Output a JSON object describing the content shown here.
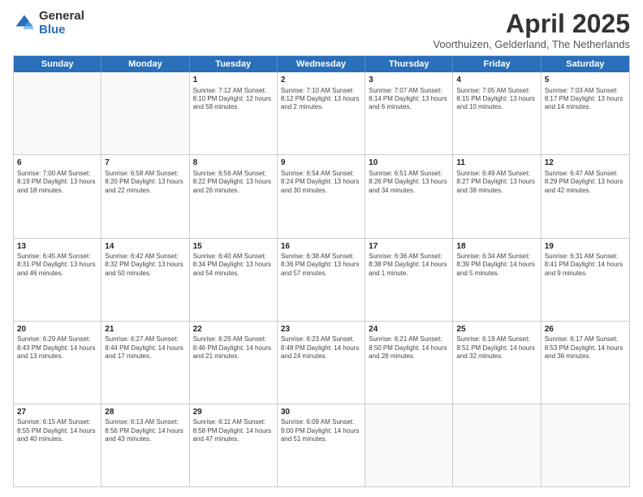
{
  "logo": {
    "general": "General",
    "blue": "Blue"
  },
  "title": "April 2025",
  "subtitle": "Voorthuizen, Gelderland, The Netherlands",
  "calendar": {
    "headers": [
      "Sunday",
      "Monday",
      "Tuesday",
      "Wednesday",
      "Thursday",
      "Friday",
      "Saturday"
    ],
    "rows": [
      [
        {
          "day": "",
          "info": ""
        },
        {
          "day": "",
          "info": ""
        },
        {
          "day": "1",
          "info": "Sunrise: 7:12 AM\nSunset: 8:10 PM\nDaylight: 12 hours\nand 58 minutes."
        },
        {
          "day": "2",
          "info": "Sunrise: 7:10 AM\nSunset: 8:12 PM\nDaylight: 13 hours\nand 2 minutes."
        },
        {
          "day": "3",
          "info": "Sunrise: 7:07 AM\nSunset: 8:14 PM\nDaylight: 13 hours\nand 6 minutes."
        },
        {
          "day": "4",
          "info": "Sunrise: 7:05 AM\nSunset: 8:15 PM\nDaylight: 13 hours\nand 10 minutes."
        },
        {
          "day": "5",
          "info": "Sunrise: 7:03 AM\nSunset: 8:17 PM\nDaylight: 13 hours\nand 14 minutes."
        }
      ],
      [
        {
          "day": "6",
          "info": "Sunrise: 7:00 AM\nSunset: 8:19 PM\nDaylight: 13 hours\nand 18 minutes."
        },
        {
          "day": "7",
          "info": "Sunrise: 6:58 AM\nSunset: 8:20 PM\nDaylight: 13 hours\nand 22 minutes."
        },
        {
          "day": "8",
          "info": "Sunrise: 6:56 AM\nSunset: 8:22 PM\nDaylight: 13 hours\nand 26 minutes."
        },
        {
          "day": "9",
          "info": "Sunrise: 6:54 AM\nSunset: 8:24 PM\nDaylight: 13 hours\nand 30 minutes."
        },
        {
          "day": "10",
          "info": "Sunrise: 6:51 AM\nSunset: 8:26 PM\nDaylight: 13 hours\nand 34 minutes."
        },
        {
          "day": "11",
          "info": "Sunrise: 6:49 AM\nSunset: 8:27 PM\nDaylight: 13 hours\nand 38 minutes."
        },
        {
          "day": "12",
          "info": "Sunrise: 6:47 AM\nSunset: 8:29 PM\nDaylight: 13 hours\nand 42 minutes."
        }
      ],
      [
        {
          "day": "13",
          "info": "Sunrise: 6:45 AM\nSunset: 8:31 PM\nDaylight: 13 hours\nand 46 minutes."
        },
        {
          "day": "14",
          "info": "Sunrise: 6:42 AM\nSunset: 8:32 PM\nDaylight: 13 hours\nand 50 minutes."
        },
        {
          "day": "15",
          "info": "Sunrise: 6:40 AM\nSunset: 8:34 PM\nDaylight: 13 hours\nand 54 minutes."
        },
        {
          "day": "16",
          "info": "Sunrise: 6:38 AM\nSunset: 8:36 PM\nDaylight: 13 hours\nand 57 minutes."
        },
        {
          "day": "17",
          "info": "Sunrise: 6:36 AM\nSunset: 8:38 PM\nDaylight: 14 hours\nand 1 minute."
        },
        {
          "day": "18",
          "info": "Sunrise: 6:34 AM\nSunset: 8:39 PM\nDaylight: 14 hours\nand 5 minutes."
        },
        {
          "day": "19",
          "info": "Sunrise: 6:31 AM\nSunset: 8:41 PM\nDaylight: 14 hours\nand 9 minutes."
        }
      ],
      [
        {
          "day": "20",
          "info": "Sunrise: 6:29 AM\nSunset: 8:43 PM\nDaylight: 14 hours\nand 13 minutes."
        },
        {
          "day": "21",
          "info": "Sunrise: 6:27 AM\nSunset: 8:44 PM\nDaylight: 14 hours\nand 17 minutes."
        },
        {
          "day": "22",
          "info": "Sunrise: 6:25 AM\nSunset: 8:46 PM\nDaylight: 14 hours\nand 21 minutes."
        },
        {
          "day": "23",
          "info": "Sunrise: 6:23 AM\nSunset: 8:48 PM\nDaylight: 14 hours\nand 24 minutes."
        },
        {
          "day": "24",
          "info": "Sunrise: 6:21 AM\nSunset: 8:50 PM\nDaylight: 14 hours\nand 28 minutes."
        },
        {
          "day": "25",
          "info": "Sunrise: 6:19 AM\nSunset: 8:51 PM\nDaylight: 14 hours\nand 32 minutes."
        },
        {
          "day": "26",
          "info": "Sunrise: 6:17 AM\nSunset: 8:53 PM\nDaylight: 14 hours\nand 36 minutes."
        }
      ],
      [
        {
          "day": "27",
          "info": "Sunrise: 6:15 AM\nSunset: 8:55 PM\nDaylight: 14 hours\nand 40 minutes."
        },
        {
          "day": "28",
          "info": "Sunrise: 6:13 AM\nSunset: 8:56 PM\nDaylight: 14 hours\nand 43 minutes."
        },
        {
          "day": "29",
          "info": "Sunrise: 6:11 AM\nSunset: 8:58 PM\nDaylight: 14 hours\nand 47 minutes."
        },
        {
          "day": "30",
          "info": "Sunrise: 6:09 AM\nSunset: 9:00 PM\nDaylight: 14 hours\nand 51 minutes."
        },
        {
          "day": "",
          "info": ""
        },
        {
          "day": "",
          "info": ""
        },
        {
          "day": "",
          "info": ""
        }
      ]
    ]
  }
}
